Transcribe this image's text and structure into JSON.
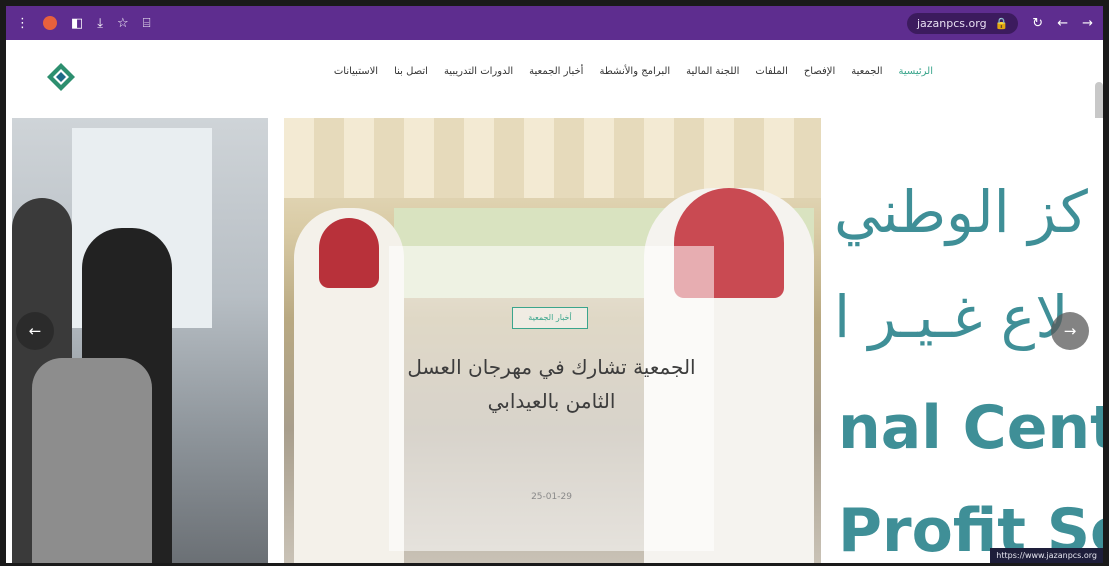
{
  "browser": {
    "url": "jazanpcs.org",
    "status_url": "https://www.jazanpcs.org"
  },
  "nav": {
    "items": [
      {
        "label": "الرئيسية",
        "active": true
      },
      {
        "label": "الجمعية"
      },
      {
        "label": "الإفصاح"
      },
      {
        "label": "الملفات"
      },
      {
        "label": "اللجنة المالية"
      },
      {
        "label": "البرامج والأنشطة"
      },
      {
        "label": "أخبار الجمعية"
      },
      {
        "label": "الدورات التدريبية"
      },
      {
        "label": "اتصل بنا"
      },
      {
        "label": "الاستبيانات"
      }
    ]
  },
  "slide": {
    "tag": "أخبار الجمعية",
    "headline": "الجمعية تشارك في مهرجان العسل الثامن بالعيدابي",
    "date": "25-01-29"
  },
  "right_banner": {
    "ar_line1": "كز الوطني",
    "ar_line2": "لاع غـيـر ا",
    "en_line1": "nal Cente",
    "en_line2": "Profit Se"
  },
  "colors": {
    "browser_bar": "#5e2d8f",
    "accent": "#3aa58c",
    "banner_text": "#3f8f97"
  },
  "icons": {
    "prev": "arrow-left-icon",
    "next": "arrow-right-icon"
  }
}
